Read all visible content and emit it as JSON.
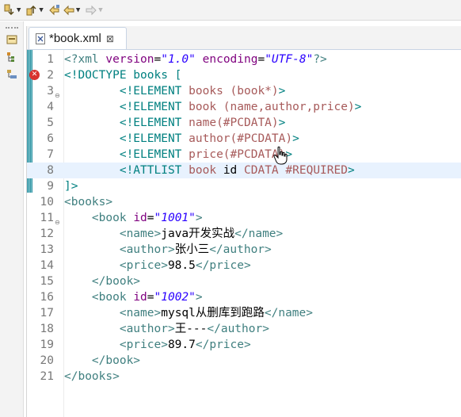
{
  "toolbar": {
    "items": [
      {
        "icon": "next-annotation-icon"
      },
      {
        "icon": "previous-annotation-icon"
      },
      {
        "icon": "last-edit-location-icon"
      },
      {
        "icon": "back-arrow-icon"
      },
      {
        "icon": "forward-arrow-icon",
        "disabled": true
      }
    ]
  },
  "sidebar": {
    "items": [
      {
        "icon": "package-explorer-icon"
      },
      {
        "icon": "type-hierarchy-icon"
      },
      {
        "icon": "outline-icon"
      }
    ]
  },
  "tab": {
    "label": "*book.xml",
    "close_symbol": "⊠"
  },
  "editor": {
    "lines": [
      {
        "num": "1",
        "tokens": [
          {
            "t": "<?xml ",
            "c": "c-pi"
          },
          {
            "t": "version",
            "c": "c-attr"
          },
          {
            "t": "=",
            "c": "c-txt"
          },
          {
            "t": "\"1.0\"",
            "c": "c-val"
          },
          {
            "t": " ",
            "c": "c-txt"
          },
          {
            "t": "encoding",
            "c": "c-attr"
          },
          {
            "t": "=",
            "c": "c-txt"
          },
          {
            "t": "\"UTF-8\"",
            "c": "c-val"
          },
          {
            "t": "?>",
            "c": "c-pi"
          }
        ]
      },
      {
        "num": "2",
        "error": true,
        "tokens": [
          {
            "t": "<!DOCTYPE books [",
            "c": "c-dtd"
          }
        ]
      },
      {
        "num": "3",
        "fold": true,
        "tokens": [
          {
            "t": "        ",
            "c": "c-txt"
          },
          {
            "t": "<!ELEMENT ",
            "c": "c-dtd"
          },
          {
            "t": "books (book*)",
            "c": "c-elem"
          },
          {
            "t": ">",
            "c": "c-dtd"
          }
        ]
      },
      {
        "num": "4",
        "tokens": [
          {
            "t": "        ",
            "c": "c-txt"
          },
          {
            "t": "<!ELEMENT ",
            "c": "c-dtd"
          },
          {
            "t": "book (name,author,price)",
            "c": "c-elem"
          },
          {
            "t": ">",
            "c": "c-dtd"
          }
        ]
      },
      {
        "num": "5",
        "tokens": [
          {
            "t": "        ",
            "c": "c-txt"
          },
          {
            "t": "<!ELEMENT ",
            "c": "c-dtd"
          },
          {
            "t": "name(#PCDATA)",
            "c": "c-elem"
          },
          {
            "t": ">",
            "c": "c-dtd"
          }
        ]
      },
      {
        "num": "6",
        "tokens": [
          {
            "t": "        ",
            "c": "c-txt"
          },
          {
            "t": "<!ELEMENT ",
            "c": "c-dtd"
          },
          {
            "t": "author(#PCDATA)",
            "c": "c-elem"
          },
          {
            "t": ">",
            "c": "c-dtd"
          }
        ]
      },
      {
        "num": "7",
        "tokens": [
          {
            "t": "        ",
            "c": "c-txt"
          },
          {
            "t": "<!ELEMENT ",
            "c": "c-dtd"
          },
          {
            "t": "price(#PCDATA)",
            "c": "c-elem"
          },
          {
            "t": ">",
            "c": "c-dtd"
          }
        ]
      },
      {
        "num": "8",
        "current": true,
        "tokens": [
          {
            "t": "        ",
            "c": "c-txt"
          },
          {
            "t": "<!ATTLIST ",
            "c": "c-dtd"
          },
          {
            "t": "book ",
            "c": "c-elem"
          },
          {
            "t": "id ",
            "c": "c-txt"
          },
          {
            "t": "CDATA #REQUIRED",
            "c": "c-elem"
          },
          {
            "t": ">",
            "c": "c-dtd"
          }
        ]
      },
      {
        "num": "9",
        "tokens": [
          {
            "t": "]>",
            "c": "c-dtd"
          }
        ]
      },
      {
        "num": "10",
        "tokens": [
          {
            "t": "<books>",
            "c": "c-tag"
          }
        ]
      },
      {
        "num": "11",
        "fold": true,
        "tokens": [
          {
            "t": "    ",
            "c": "c-txt"
          },
          {
            "t": "<book ",
            "c": "c-tag"
          },
          {
            "t": "id",
            "c": "c-attr"
          },
          {
            "t": "=",
            "c": "c-txt"
          },
          {
            "t": "\"1001\"",
            "c": "c-val"
          },
          {
            "t": ">",
            "c": "c-tag"
          }
        ]
      },
      {
        "num": "12",
        "tokens": [
          {
            "t": "        ",
            "c": "c-txt"
          },
          {
            "t": "<name>",
            "c": "c-tag"
          },
          {
            "t": "java开发实战",
            "c": "c-txt"
          },
          {
            "t": "</name>",
            "c": "c-tag"
          }
        ]
      },
      {
        "num": "13",
        "tokens": [
          {
            "t": "        ",
            "c": "c-txt"
          },
          {
            "t": "<author>",
            "c": "c-tag"
          },
          {
            "t": "张小三",
            "c": "c-txt"
          },
          {
            "t": "</author>",
            "c": "c-tag"
          }
        ]
      },
      {
        "num": "14",
        "tokens": [
          {
            "t": "        ",
            "c": "c-txt"
          },
          {
            "t": "<price>",
            "c": "c-tag"
          },
          {
            "t": "98.5",
            "c": "c-txt"
          },
          {
            "t": "</price>",
            "c": "c-tag"
          }
        ]
      },
      {
        "num": "15",
        "tokens": [
          {
            "t": "    ",
            "c": "c-txt"
          },
          {
            "t": "</book>",
            "c": "c-tag"
          }
        ]
      },
      {
        "num": "16",
        "tokens": [
          {
            "t": "    ",
            "c": "c-txt"
          },
          {
            "t": "<book ",
            "c": "c-tag"
          },
          {
            "t": "id",
            "c": "c-attr"
          },
          {
            "t": "=",
            "c": "c-txt"
          },
          {
            "t": "\"1002\"",
            "c": "c-val"
          },
          {
            "t": ">",
            "c": "c-tag"
          }
        ]
      },
      {
        "num": "17",
        "tokens": [
          {
            "t": "        ",
            "c": "c-txt"
          },
          {
            "t": "<name>",
            "c": "c-tag"
          },
          {
            "t": "mysql从删库到跑路",
            "c": "c-txt"
          },
          {
            "t": "</name>",
            "c": "c-tag"
          }
        ]
      },
      {
        "num": "18",
        "tokens": [
          {
            "t": "        ",
            "c": "c-txt"
          },
          {
            "t": "<author>",
            "c": "c-tag"
          },
          {
            "t": "王---",
            "c": "c-txt"
          },
          {
            "t": "</author>",
            "c": "c-tag"
          }
        ]
      },
      {
        "num": "19",
        "tokens": [
          {
            "t": "        ",
            "c": "c-txt"
          },
          {
            "t": "<price>",
            "c": "c-tag"
          },
          {
            "t": "89.7",
            "c": "c-txt"
          },
          {
            "t": "</price>",
            "c": "c-tag"
          }
        ]
      },
      {
        "num": "20",
        "tokens": [
          {
            "t": "    ",
            "c": "c-txt"
          },
          {
            "t": "</book>",
            "c": "c-tag"
          }
        ]
      },
      {
        "num": "21",
        "tokens": [
          {
            "t": "</books>",
            "c": "c-tag"
          }
        ]
      }
    ]
  },
  "colors": {
    "line_number": "#787878",
    "current_line": "#e8f2fe",
    "attribute": "#7f007f",
    "attribute_value": "#2a00ff",
    "tag": "#3f7f7f",
    "dtd_keyword": "#008080",
    "dtd_element": "#a75a5a",
    "error_marker": "#d8332f",
    "change_bar": "#2f8fa0"
  }
}
